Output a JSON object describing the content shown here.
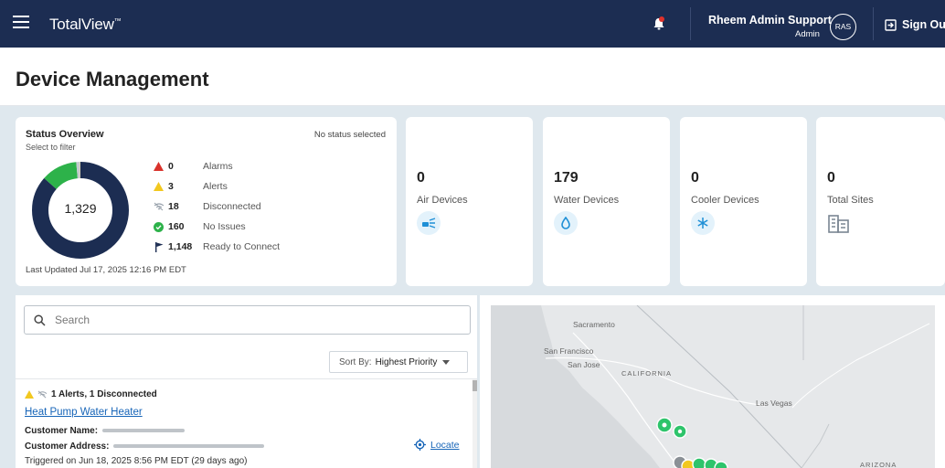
{
  "header": {
    "brand": "TotalView",
    "brand_mark": "™",
    "user_name": "Rheem Admin Support",
    "user_role": "Admin",
    "avatar_initials": "RAS",
    "sign_out": "Sign Out",
    "bell_alert_color": "#e0312b",
    "background": "#1c2d52"
  },
  "page": {
    "title": "Device Management"
  },
  "status_overview": {
    "title": "Status Overview",
    "subtitle": "Select to filter",
    "no_selection": "No status selected",
    "total": "1,329",
    "legend": [
      {
        "icon": "alarm-triangle-icon",
        "count": "0",
        "label": "Alarms",
        "color": "#d9322b"
      },
      {
        "icon": "alert-triangle-icon",
        "count": "3",
        "label": "Alerts",
        "color": "#f2c81f"
      },
      {
        "icon": "wifi-off-icon",
        "count": "18",
        "label": "Disconnected",
        "color": "#9aa3ad"
      },
      {
        "icon": "check-circle-icon",
        "count": "160",
        "label": "No Issues",
        "color": "#2db24a"
      },
      {
        "icon": "flag-icon",
        "count": "1,148",
        "label": "Ready to Connect",
        "color": "#1c2d52"
      }
    ],
    "donut_segments": [
      {
        "status": "Ready to Connect",
        "value": 1148,
        "color": "#1c2d52"
      },
      {
        "status": "No Issues",
        "value": 160,
        "color": "#2db24a"
      },
      {
        "status": "Disconnected",
        "value": 18,
        "color": "#c4c9cf"
      },
      {
        "status": "Alerts",
        "value": 3,
        "color": "#f2c81f"
      }
    ],
    "last_updated": "Last Updated Jul 17, 2025 12:16 PM EDT"
  },
  "device_cards": [
    {
      "count": "0",
      "label": "Air Devices",
      "icon": "air-device-icon"
    },
    {
      "count": "179",
      "label": "Water Devices",
      "icon": "water-drop-icon"
    },
    {
      "count": "0",
      "label": "Cooler Devices",
      "icon": "snowflake-icon"
    },
    {
      "count": "0",
      "label": "Total Sites",
      "icon": "building-icon"
    }
  ],
  "device_list": {
    "search_placeholder": "Search",
    "sort_label": "Sort By:",
    "sort_value": "Highest Priority",
    "item": {
      "alerts": "1 Alerts, 1 Disconnected",
      "title": "Heat Pump Water Heater",
      "customer_name_label": "Customer Name:",
      "customer_address_label": "Customer Address:",
      "locate": "Locate",
      "triggered": "Triggered on Jun 18, 2025 8:56 PM EDT  (29 days ago)"
    }
  },
  "map": {
    "labels": {
      "sacramento": "Sacramento",
      "san_francisco": "San Francisco",
      "san_jose": "San Jose",
      "california": "CALIFORNIA",
      "las_vegas": "Las Vegas",
      "arizona": "ARIZONA"
    },
    "marker_color": "#2ec46b"
  },
  "colors": {
    "accent_link": "#1765b8",
    "page_bg": "#dfe8ee"
  }
}
